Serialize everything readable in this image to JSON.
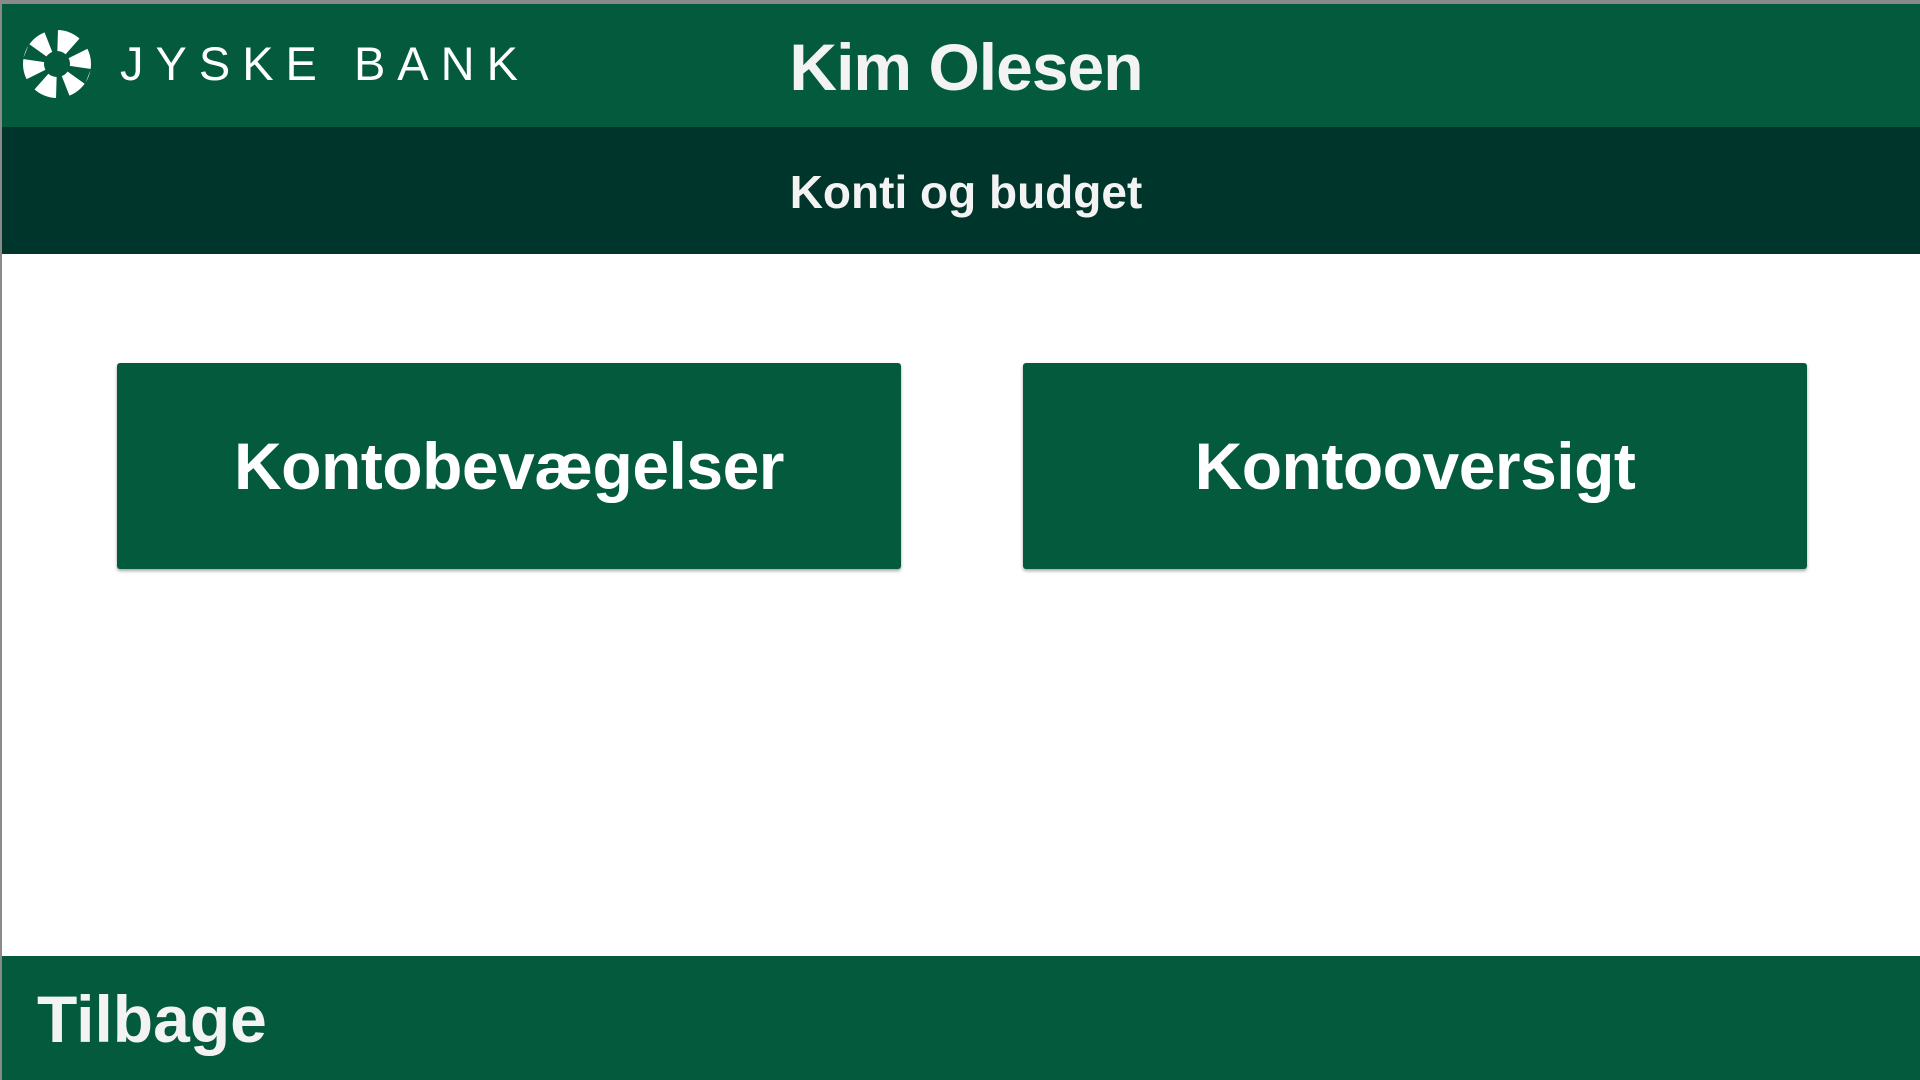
{
  "header": {
    "logo_icon": "jyske-bank-shutter-logo",
    "brand_name": "JYSKE BANK",
    "user_name": "Kim Olesen"
  },
  "subheader": {
    "title": "Konti og budget"
  },
  "main": {
    "tiles": [
      {
        "label": "Kontobevægelser"
      },
      {
        "label": "Kontooversigt"
      }
    ]
  },
  "footer": {
    "back_label": "Tilbage"
  },
  "colors": {
    "brand_green": "#035a3c",
    "dark_green": "#00352c",
    "text_light": "#f3f3f3",
    "background": "#ffffff"
  }
}
